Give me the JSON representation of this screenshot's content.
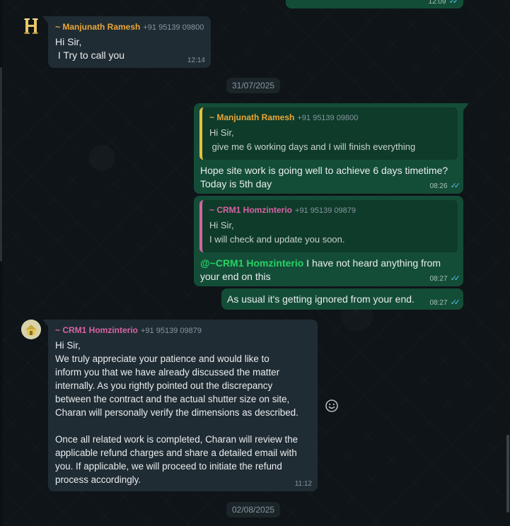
{
  "top_partial": {
    "time": "12:09"
  },
  "msg1": {
    "sender": "~ Manjunath Ramesh",
    "phone": "+91 95139 09800",
    "text": "Hi Sir,\n I Try to call you",
    "time": "12:14"
  },
  "date1": "31/07/2025",
  "msg2": {
    "quote": {
      "sender": "~ Manjunath Ramesh",
      "phone": "+91 95139 09800",
      "text": "Hi Sir,\n give me 6 working days and I will finish everything"
    },
    "text": "Hope site work is going well to achieve 6 days timetime?\nToday is 5th day",
    "time": "08:26"
  },
  "msg3": {
    "quote": {
      "sender": "~ CRM1 Homzinterio",
      "phone": "+91 95139 09879",
      "text": "Hi Sir,\nI will check and update you soon."
    },
    "mention": "@~CRM1 Homzinterio",
    "text_line1": " I have not heard anything from",
    "text_line2": "your end on this",
    "time": "08:27"
  },
  "msg4": {
    "text": "As usual it's getting ignored from your end.",
    "time": "08:27"
  },
  "msg5": {
    "sender": "~ CRM1 Homzinterio",
    "phone": "+91 95139 09879",
    "text": "Hi Sir,\nWe truly appreciate your patience and would like to\ninform you that we have already discussed the matter\ninternally. As you rightly pointed out the discrepancy\nbetween the contract and the actual shutter size on site,\nCharan will personally verify the dimensions as described.\n\nOnce all related work is completed, Charan will review the\napplicable refund charges and share a detailed email with\nyou. If applicable, we will proceed to initiate the refund\nprocess accordingly.",
    "time": "11:12"
  },
  "date2": "02/08/2025",
  "icons": {
    "read_ticks": "double-check-icon",
    "emoji": "smiley-icon"
  },
  "colors": {
    "outgoing_bubble": "#144d37",
    "incoming_bubble": "#202c33",
    "sender_orange": "#e9a638",
    "sender_pink": "#d763a5",
    "mention_green": "#25d366",
    "read_tick_blue": "#53bdeb"
  }
}
